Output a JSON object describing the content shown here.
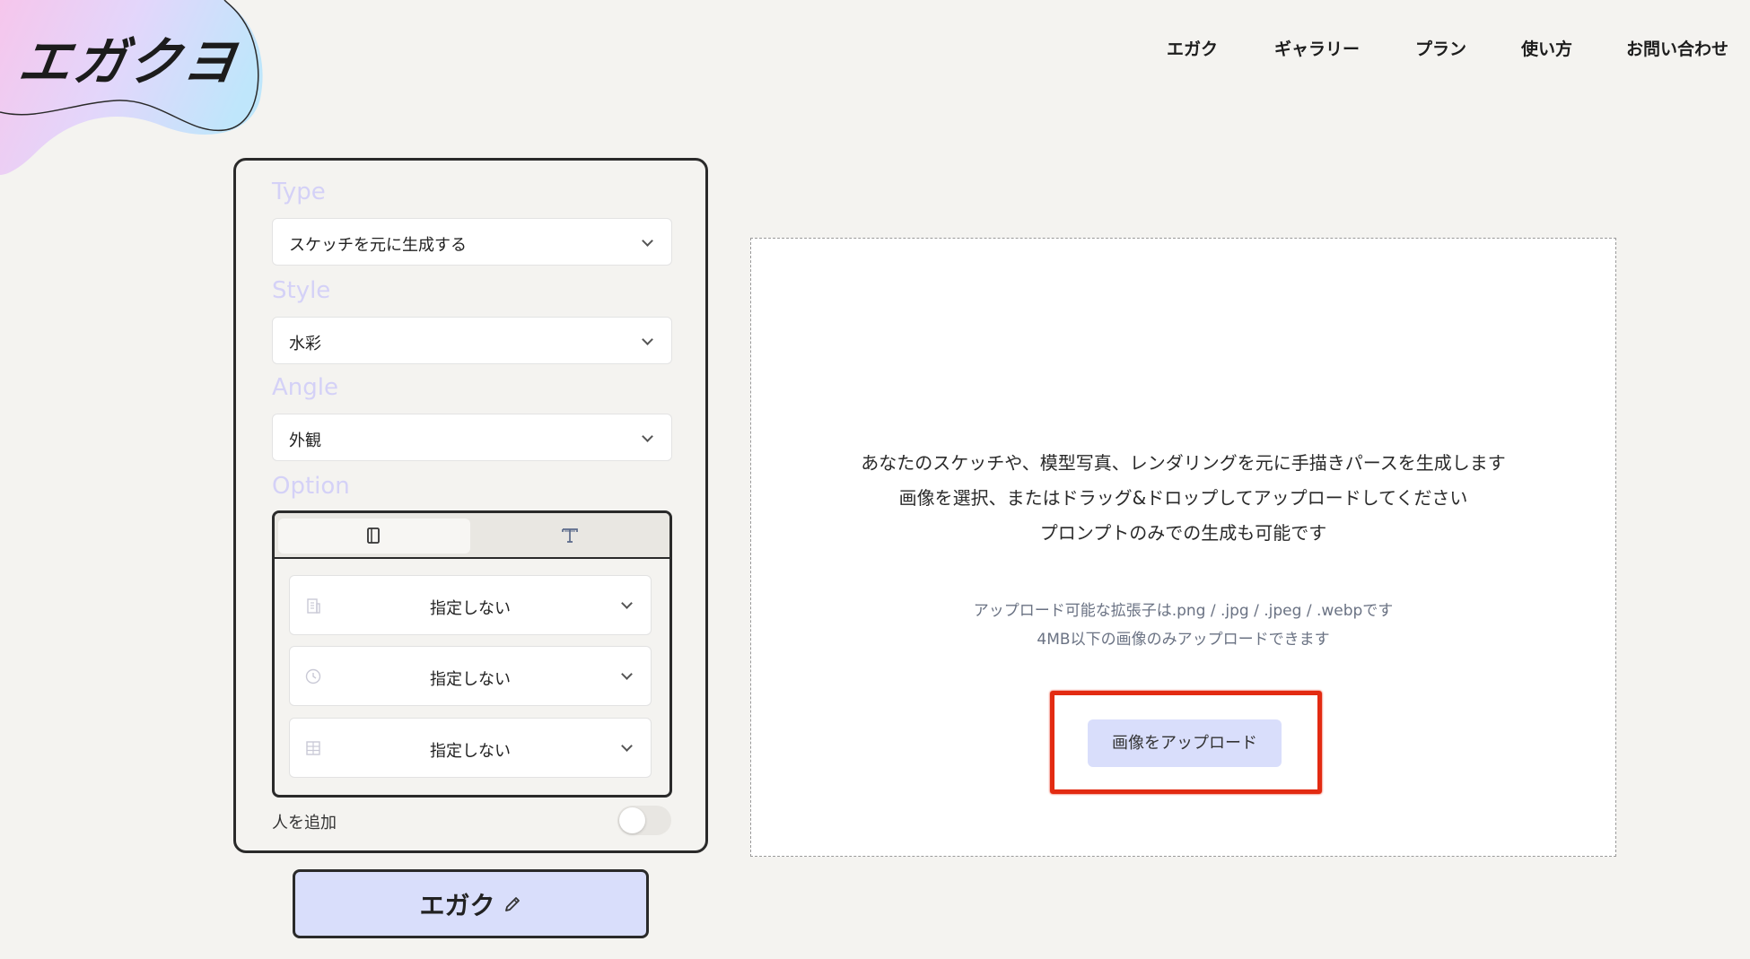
{
  "brand": {
    "logo_text": "エガクヨ"
  },
  "nav": {
    "items": [
      "エガク",
      "ギャラリー",
      "プラン",
      "使い方",
      "お問い合わせ"
    ]
  },
  "panel": {
    "type_label": "Type",
    "type_value": "スケッチを元に生成する",
    "style_label": "Style",
    "style_value": "水彩",
    "angle_label": "Angle",
    "angle_value": "外観",
    "option_label": "Option",
    "option_tabs": [
      "layout-icon",
      "text-icon"
    ],
    "option_rows": [
      {
        "icon": "building-icon",
        "value": "指定しない"
      },
      {
        "icon": "clock-icon",
        "value": "指定しない"
      },
      {
        "icon": "grid-icon",
        "value": "指定しない"
      }
    ],
    "toggle_label": "人を追加",
    "toggle_on": false,
    "generate_label": "エガク"
  },
  "dropzone": {
    "line1": "あなたのスケッチや、模型写真、レンダリングを元に手描きパースを生成します",
    "line2": "画像を選択、またはドラッグ&ドロップしてアップロードしてください",
    "line3": "プロンプトのみでの生成も可能です",
    "note1": "アップロード可能な拡張子は.png / .jpg / .jpeg / .webpです",
    "note2": "4MB以下の画像のみアップロードできます",
    "upload_label": "画像をアップロード"
  },
  "colors": {
    "accent": "#d9defb",
    "label_lavender": "#d4d1f7",
    "highlight_red": "#e32b12",
    "background": "#f4f3f0"
  }
}
